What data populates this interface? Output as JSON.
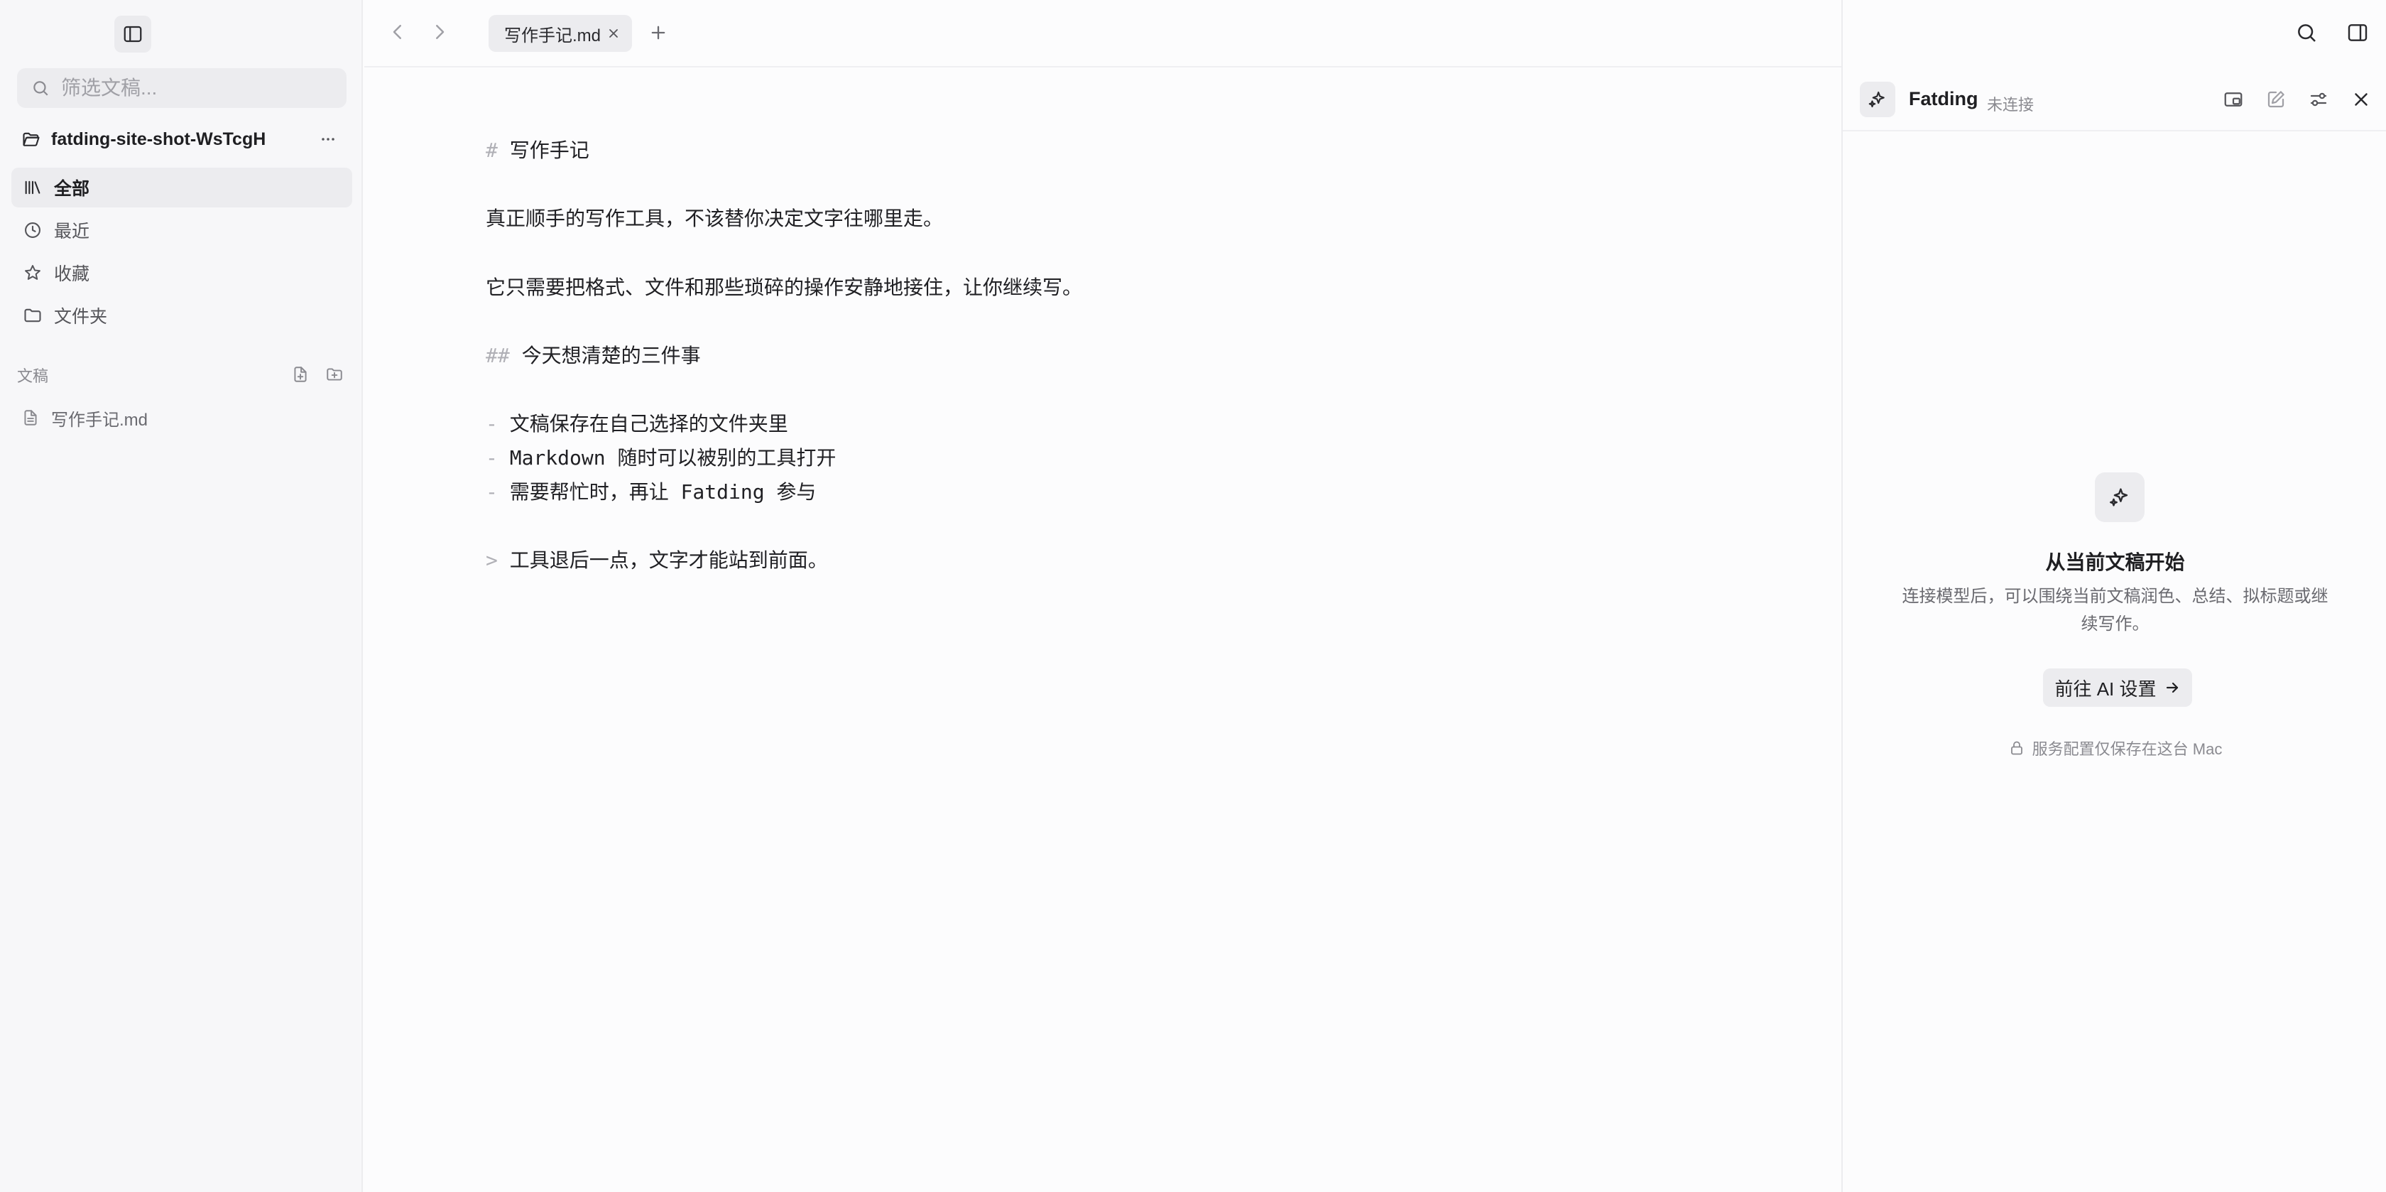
{
  "sidebar": {
    "search_placeholder": "筛选文稿...",
    "workspace_name": "fatding-site-shot-WsTcgH",
    "nav": [
      {
        "label": "全部",
        "icon": "library-icon",
        "active": true
      },
      {
        "label": "最近",
        "icon": "clock-icon",
        "active": false
      },
      {
        "label": "收藏",
        "icon": "star-icon",
        "active": false
      },
      {
        "label": "文件夹",
        "icon": "folder-icon",
        "active": false
      }
    ],
    "section_title": "文稿",
    "files": [
      {
        "label": "写作手记.md",
        "icon": "document-icon"
      }
    ]
  },
  "tabs": [
    {
      "label": "写作手记.md",
      "active": true
    }
  ],
  "editor": {
    "lines": [
      {
        "marker": "#",
        "text": "写作手记"
      },
      {
        "marker": "",
        "text": "真正顺手的写作工具，不该替你决定文字往哪里走。"
      },
      {
        "marker": "",
        "text": "它只需要把格式、文件和那些琐碎的操作安静地接住，让你继续写。"
      },
      {
        "marker": "##",
        "text": "今天想清楚的三件事"
      },
      {
        "marker": "-",
        "text": "文稿保存在自己选择的文件夹里"
      },
      {
        "marker": "-",
        "text": "Markdown 随时可以被别的工具打开"
      },
      {
        "marker": "-",
        "text": "需要帮忙时，再让 Fatding 参与"
      },
      {
        "marker": ">",
        "text": "工具退后一点，文字才能站到前面。"
      }
    ]
  },
  "ai_panel": {
    "name": "Fatding",
    "status": "未连接",
    "empty_title": "从当前文稿开始",
    "empty_desc": "连接模型后，可以围绕当前文稿润色、总结、拟标题或继续写作。",
    "button_label": "前往 AI 设置",
    "privacy_note": "服务配置仅保存在这台 Mac"
  },
  "colors": {
    "background": "#fcfcfd",
    "sidebar": "#f7f7f9",
    "chip": "#ececef",
    "text": "#1f1f22",
    "muted": "#8a8a90",
    "markdown_marker": "#b0b0b6"
  }
}
